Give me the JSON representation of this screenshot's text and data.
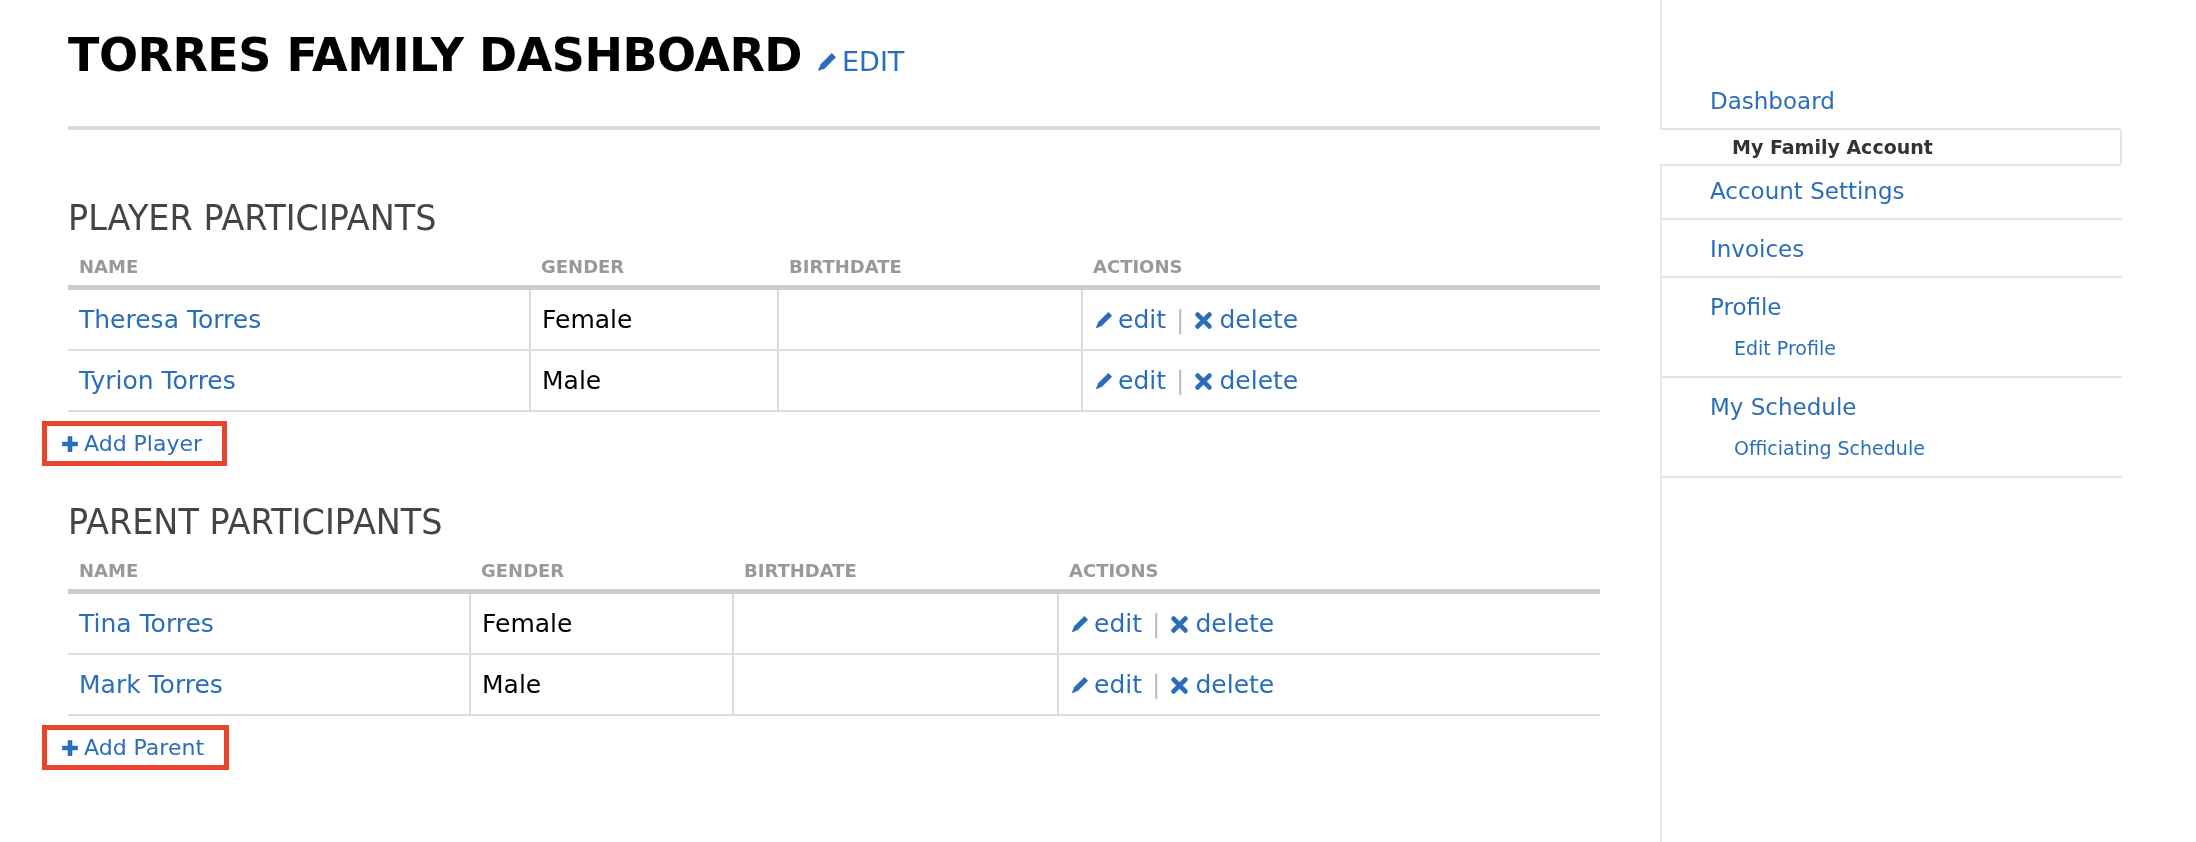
{
  "header": {
    "title": "TORRES FAMILY DASHBOARD",
    "edit_link": "EDIT"
  },
  "sections": [
    {
      "heading": "PLAYER PARTICIPANTS",
      "columns": [
        "NAME",
        "GENDER",
        "BIRTHDATE",
        "ACTIONS"
      ],
      "rows": [
        {
          "name": "Theresa Torres",
          "gender": "Female",
          "edit": "edit",
          "separator": "|",
          "delete": "delete"
        },
        {
          "name": "Tyrion Torres",
          "gender": "Male",
          "edit": "edit",
          "separator": "|",
          "delete": "delete"
        }
      ],
      "add_button": {
        "label": "Add Player",
        "highlighted": true
      }
    },
    {
      "heading": "PARENT PARTICIPANTS",
      "columns": [
        "NAME",
        "GENDER",
        "BIRTHDATE",
        "ACTIONS"
      ],
      "rows": [
        {
          "name": "Tina Torres",
          "gender": "Female",
          "edit": "edit",
          "separator": "|",
          "delete": "delete"
        },
        {
          "name": "Mark Torres",
          "gender": "Male",
          "edit": "edit",
          "separator": "|",
          "delete": "delete"
        }
      ],
      "add_button": {
        "label": "Add Parent",
        "highlighted": true
      }
    }
  ],
  "sidebar": {
    "items": [
      {
        "label": "Dashboard",
        "selected": false,
        "children": [
          {
            "label": "My Family Account",
            "selected": true
          }
        ]
      },
      {
        "label": "Account Settings",
        "selected": false
      },
      {
        "label": "Invoices",
        "selected": false
      },
      {
        "label": "Profile",
        "selected": false,
        "children": [
          {
            "label": "Edit Profile",
            "selected": false
          }
        ]
      },
      {
        "label": "My Schedule",
        "selected": false,
        "children": [
          {
            "label": "Officiating Schedule",
            "selected": false
          }
        ]
      }
    ]
  }
}
